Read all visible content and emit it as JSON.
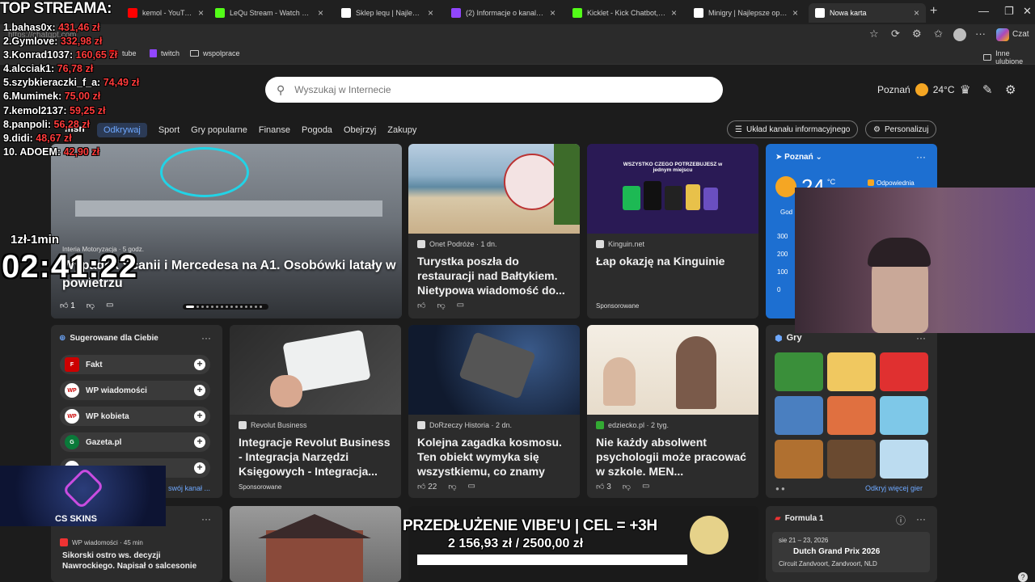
{
  "browser": {
    "tabs": [
      {
        "title": "kemol - YouTube",
        "color": "#ff0000"
      },
      {
        "title": "LeQu Stream - Watch Live o",
        "color": "#53fc18"
      },
      {
        "title": "Sklep lequ | Najlepsze oprog",
        "color": "#ffffff"
      },
      {
        "title": "(2) Informacje o kanale kajo",
        "color": "#9146ff"
      },
      {
        "title": "Kicklet - Kick Chatbot, Kick V",
        "color": "#53fc18"
      },
      {
        "title": "Minigry | Najlepsze oprogra",
        "color": "#ffffff"
      },
      {
        "title": "Nowa karta",
        "color": "#ffffff",
        "active": true
      }
    ],
    "address": "https://chatgpt.com",
    "chat_label": "Czat",
    "bookmarks": [
      {
        "label": "tube",
        "icon": "youtube-icon"
      },
      {
        "label": "twitch",
        "icon": "twitch-icon"
      },
      {
        "label": "wspolprace",
        "icon": "folder-icon"
      }
    ],
    "other_bookmarks": "Inne ulubione"
  },
  "msn": {
    "search_placeholder": "Wyszukaj w Internecie",
    "weather_city": "Poznań",
    "weather_temp": "24°C",
    "brand": "msn",
    "nav": [
      "Odkrywaj",
      "Sport",
      "Gry popularne",
      "Finanse",
      "Pogoda",
      "Obejrzyj",
      "Zakupy"
    ],
    "layout_button": "Układ kanału informacyjnego",
    "personalize_button": "Personalizuj",
    "hero": {
      "source": "Interia Motoryzacja · 5 godz.",
      "title": "Wypadek Scanii i Mercedesa na A1. Osobówki latały w powietrzu",
      "likes": "1"
    },
    "cards": [
      {
        "source": "Onet Podróże · 1 dn.",
        "title": "Turystka poszła do restauracji nad Bałtykiem. Nietypowa wiadomość do..."
      },
      {
        "source": "Kinguin.net",
        "title": "Łap okazję na Kinguinie",
        "sponsored": "Sponsorowane"
      },
      {
        "source": "Revolut Business",
        "title": "Integracje Revolut Business - Integracja Narzędzi Księgowych - Integracja...",
        "sponsored": "Sponsorowane"
      },
      {
        "source": "DoRzeczy Historia · 2 dn.",
        "title": "Kolejna zagadka kosmosu. Ten obiekt wymyka się wszystkiemu, co znamy",
        "likes": "22"
      },
      {
        "source": "edziecko.pl · 2 tyg.",
        "title": "Nie każdy absolwent psychologii może pracować w szkole. MEN...",
        "likes": "3"
      }
    ],
    "kinguin_banner": "WSZYSTKO CZEGO POTRZEBUJESZ w jednym miejscu",
    "weather_card": {
      "city": "Poznań",
      "temp": "24",
      "unit": "°C",
      "tag": "Odpowiednia",
      "label": "God",
      "ticks": [
        "300",
        "200",
        "100",
        "0"
      ]
    },
    "suggested": {
      "title": "Sugerowane dla Ciebie",
      "items": [
        "Fakt",
        "WP wiadomości",
        "WP kobieta",
        "Gazeta.pl"
      ],
      "more": "swój kanał ..."
    },
    "games": {
      "title": "Gry",
      "more": "Odkryj więcej gier",
      "colors": [
        "#3a8f3a",
        "#f0c860",
        "#e03030",
        "#4a7fc0",
        "#e07040",
        "#7ec8e8",
        "#b07030",
        "#6a4a30",
        "#bcdcf0"
      ]
    },
    "news_small": {
      "source": "WP wiadomości · 45 min",
      "title": "Sikorski ostro ws. decyzji Nawrockiego. Napisał o salcesonie"
    },
    "f1": {
      "title": "Formula 1",
      "date": "sie 21 – 23, 2026",
      "event": "Dutch Grand Prix 2026",
      "venue": "Circuit Zandvoort, Zandvoort, NLD"
    }
  },
  "overlay": {
    "top_title": "TOP STREAMA:",
    "top_list": [
      {
        "name": "1.bahas0x: ",
        "amount": "431,46 zł"
      },
      {
        "name": "2.Gymlove: ",
        "amount": "332,98 zł"
      },
      {
        "name": "3.Konrad1037: ",
        "amount": "160,65 zł"
      },
      {
        "name": "4.alcciak1: ",
        "amount": "76,78 zł"
      },
      {
        "name": "5.szybkieraczki_f_a: ",
        "amount": "74,49 zł"
      },
      {
        "name": "6.Mumimek: ",
        "amount": "75,00 zł"
      },
      {
        "name": "7.kemol2137: ",
        "amount": "59,25 zł"
      },
      {
        "name": "8.panpoli: ",
        "amount": "56,28 zł"
      },
      {
        "name": "9.didi: ",
        "amount": "48,67 zł"
      },
      {
        "name": "10. ADOEM: ",
        "amount": "42,90 zł"
      }
    ],
    "rate": "1zł-1min",
    "timer": "02:41:22",
    "ad_label": "CS SKINS",
    "goal_line1": "PRZEDŁUŻENIE VIBE'U | CEL = +3H",
    "goal_line2": "2 156,93 zł / 2500,00 zł",
    "goal_progress": 0.863
  }
}
